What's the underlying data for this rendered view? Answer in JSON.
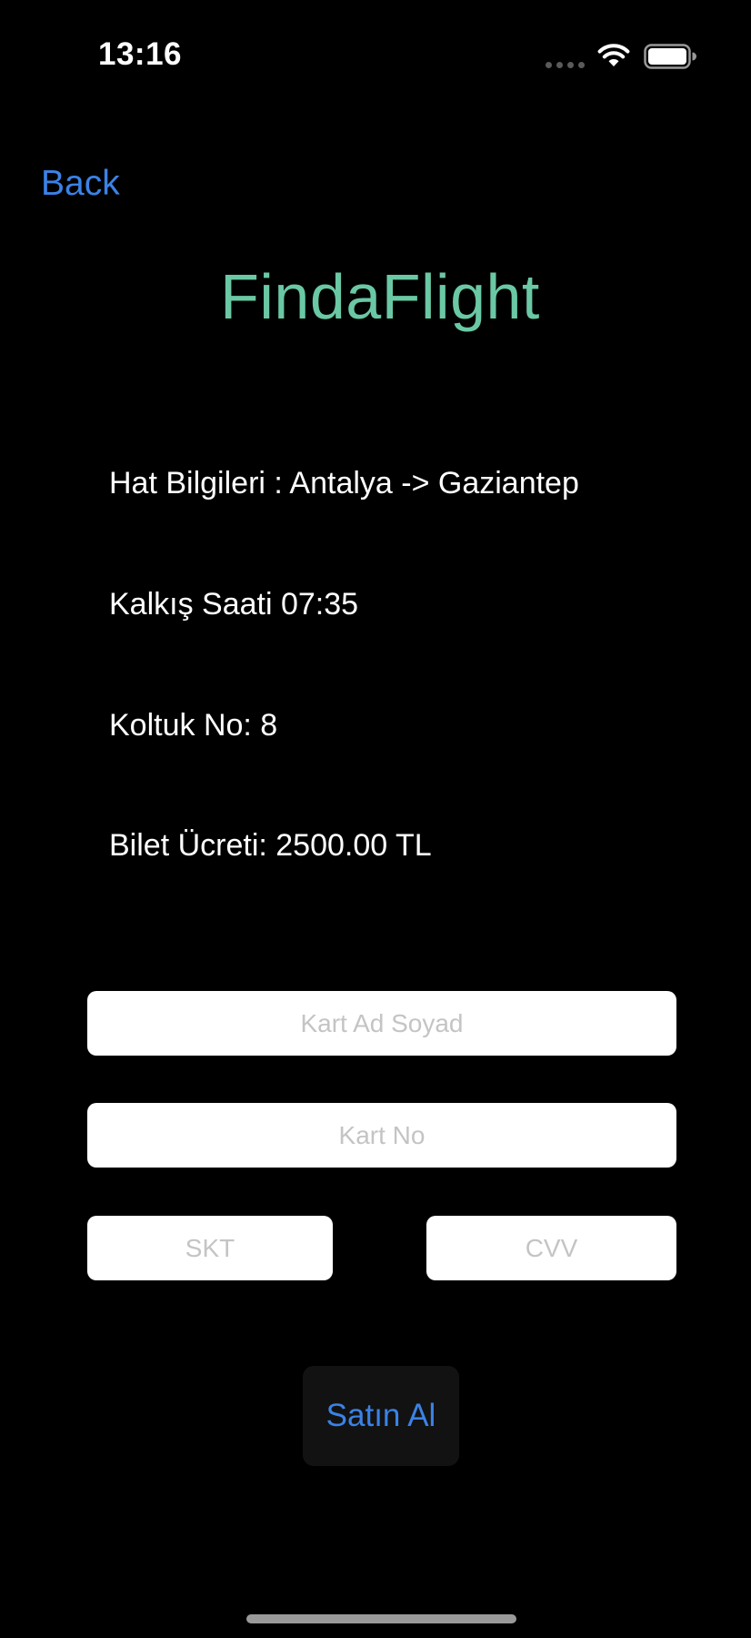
{
  "status_bar": {
    "time": "13:16",
    "icons": [
      "signal-dots-icon",
      "wifi-icon",
      "battery-icon"
    ]
  },
  "nav": {
    "back_label": "Back"
  },
  "header": {
    "title": "FindaFlight"
  },
  "ticket_info": {
    "route": "Hat Bilgileri : Antalya -> Gaziantep",
    "departure": "Kalkış Saati 07:35",
    "seat": "Koltuk No: 8",
    "price": "Bilet Ücreti: 2500.00 TL"
  },
  "payment_form": {
    "card_name": {
      "value": "",
      "placeholder": "Kart Ad Soyad"
    },
    "card_number": {
      "value": "",
      "placeholder": "Kart No"
    },
    "expiry": {
      "value": "",
      "placeholder": "SKT"
    },
    "cvv": {
      "value": "",
      "placeholder": "CVV"
    }
  },
  "actions": {
    "buy_label": "Satın Al"
  },
  "colors": {
    "background": "#000000",
    "accent": "#3b82e6",
    "title": "#6ac8a4",
    "field_background": "#ffffff",
    "placeholder": "#c4c4c4",
    "button_background": "#121212"
  }
}
